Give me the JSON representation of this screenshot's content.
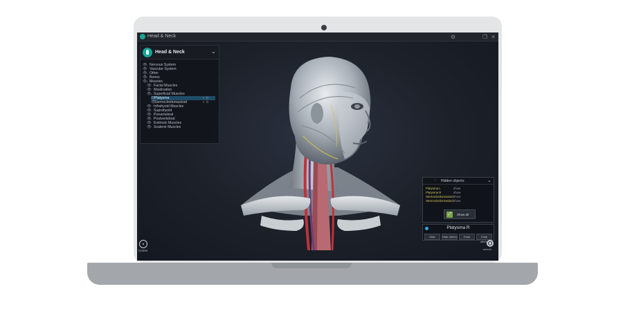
{
  "window": {
    "title": "Head & Neck"
  },
  "panel": {
    "title": "Head & Neck",
    "rows": [
      {
        "label": "Nervous System"
      },
      {
        "label": "Vascular System"
      },
      {
        "label": "Other"
      },
      {
        "label": "Bones"
      },
      {
        "label": "Muscles"
      },
      {
        "label": "Facial Muscles"
      },
      {
        "label": "Mastication"
      },
      {
        "label": "Superficial Muscles"
      },
      {
        "label": "Platysma"
      },
      {
        "label": "Sternocleidomastoid"
      },
      {
        "label": "Infrahyoid Muscles"
      },
      {
        "label": "Suprahyoid"
      },
      {
        "label": "Prevertebral"
      },
      {
        "label": "Postvertebral"
      },
      {
        "label": "Extrinsic Muscles"
      },
      {
        "label": "Scalene Muscles"
      }
    ]
  },
  "hidden_objects": {
    "title": "Hidden objects:",
    "items": [
      {
        "name": "Platysma L",
        "action": "show"
      },
      {
        "name": "Platysma R",
        "action": "show"
      },
      {
        "name": "Sternocleidomastoid",
        "action": "show"
      },
      {
        "name": "Sternocleidomastoid",
        "action": "show"
      }
    ],
    "show_all_label": "Show all"
  },
  "selection": {
    "title": "Platysma R",
    "buttons": [
      "Hide",
      "Hide others",
      "Fade",
      "Fade others"
    ]
  },
  "controls": {
    "center_label": "Center",
    "search_label": "search"
  },
  "colors": {
    "accent": "#17a498",
    "selected_row": "#1f4c67",
    "hidden_item_text": "#d4c35a"
  }
}
